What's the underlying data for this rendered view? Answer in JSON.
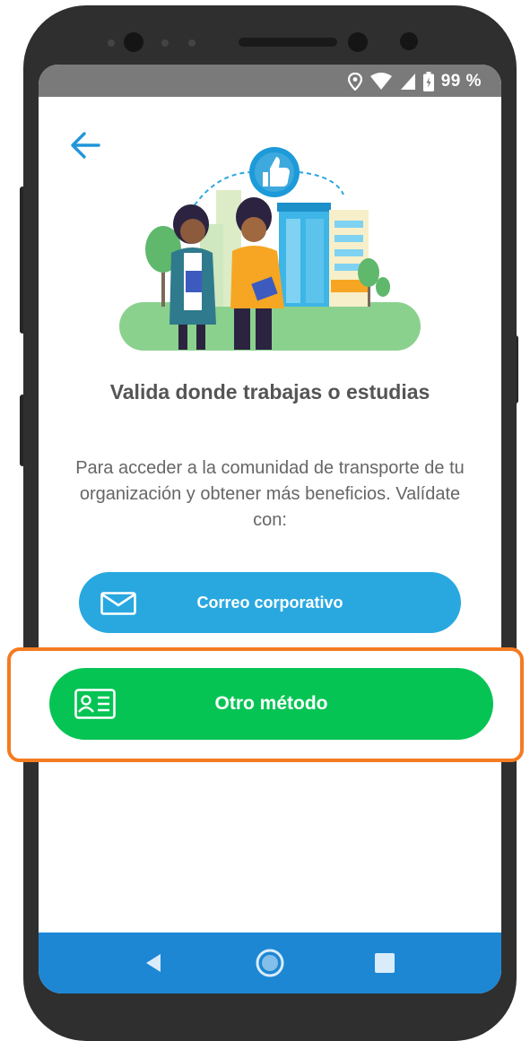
{
  "status": {
    "battery_percent": "99 %",
    "icons": [
      "location-icon",
      "wifi-icon",
      "signal-icon",
      "battery-icon"
    ]
  },
  "screen": {
    "title": "Valida donde trabajas o estudias",
    "subtitle": "Para acceder a la comunidad de transporte de tu organización y obtener más beneficios. Valídate con:",
    "illustration": "students-building-thumbs-up-illustration"
  },
  "buttons": {
    "corporate_email": {
      "label": "Correo corporativo",
      "icon": "mail-icon",
      "color": "#29a8e0"
    },
    "other_method": {
      "label": "Otro método",
      "icon": "id-card-icon",
      "color": "#06c454"
    }
  },
  "highlight_color": "#f47b20",
  "navbar": {
    "color": "#1d87d4",
    "items": [
      "back-icon",
      "home-icon",
      "recents-icon"
    ]
  }
}
